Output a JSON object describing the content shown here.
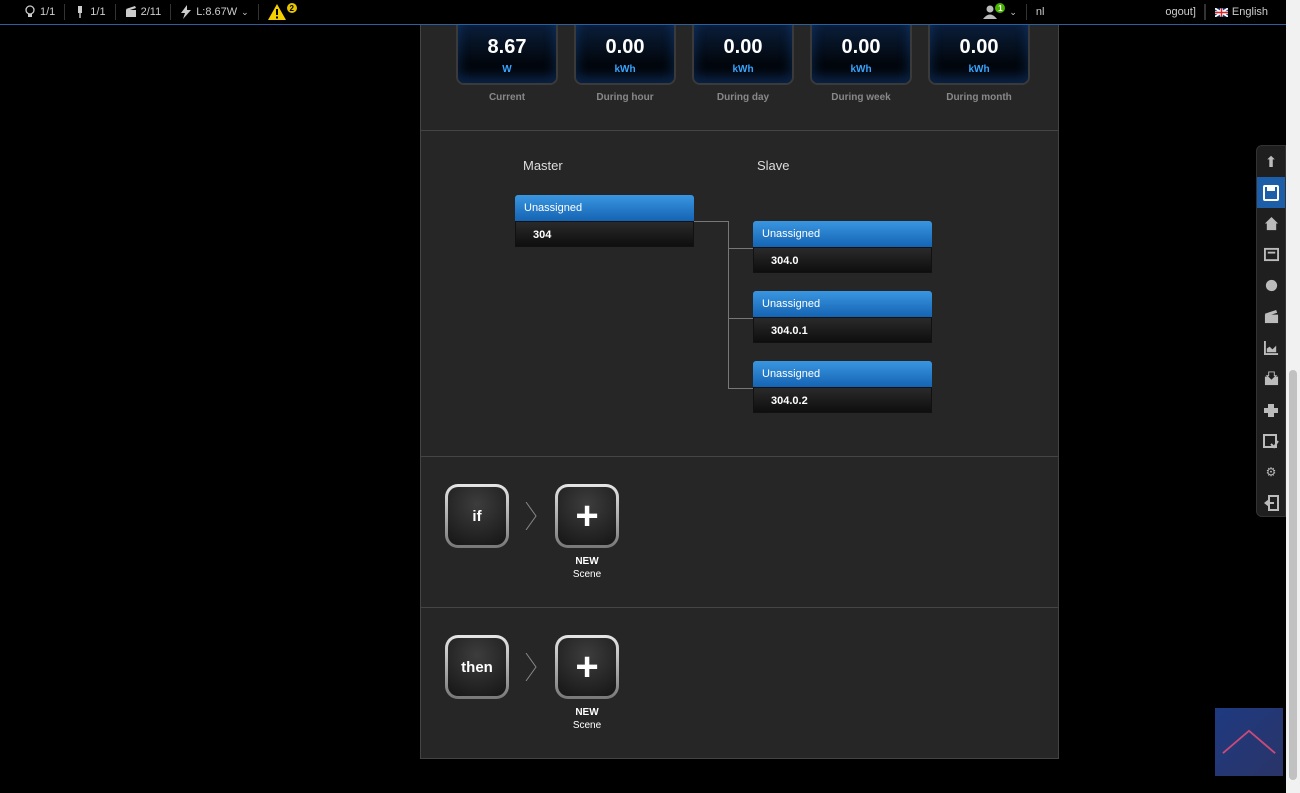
{
  "topbar": {
    "lights": "1/1",
    "plugs": "1/1",
    "scenes": "2/11",
    "power": "L:8.67W",
    "warnings": "2",
    "user_badge": "1",
    "username": "nl",
    "logout": "ogout]",
    "language": "English"
  },
  "meters": [
    {
      "value": "8.67",
      "unit": "W",
      "label": "Current"
    },
    {
      "value": "0.00",
      "unit": "kWh",
      "label": "During hour"
    },
    {
      "value": "0.00",
      "unit": "kWh",
      "label": "During day"
    },
    {
      "value": "0.00",
      "unit": "kWh",
      "label": "During week"
    },
    {
      "value": "0.00",
      "unit": "kWh",
      "label": "During month"
    }
  ],
  "tree": {
    "master_heading": "Master",
    "slave_heading": "Slave",
    "master": {
      "status": "Unassigned",
      "id": "304"
    },
    "slaves": [
      {
        "status": "Unassigned",
        "id": "304.0"
      },
      {
        "status": "Unassigned",
        "id": "304.0.1"
      },
      {
        "status": "Unassigned",
        "id": "304.0.2"
      }
    ]
  },
  "rules": {
    "if_label": "if",
    "then_label": "then",
    "new_line1": "NEW",
    "new_line2": "Scene"
  }
}
